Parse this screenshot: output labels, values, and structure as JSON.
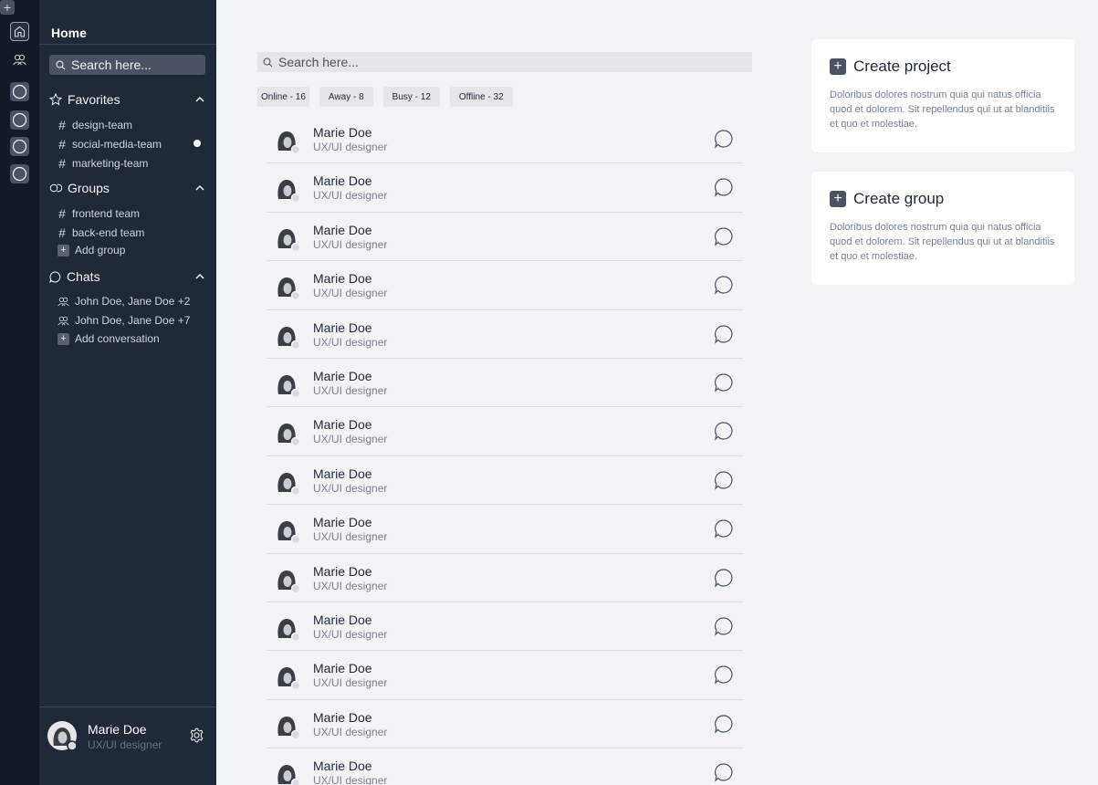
{
  "colors": {
    "rail_bg": "#131a26",
    "sidebar_bg": "#1f2938",
    "main_bg": "#f2f3f5",
    "card_bg": "#ffffff",
    "text_dark": "#1f2938",
    "text_muted": "#7b8290"
  },
  "rail": {
    "icons": [
      "home-icon",
      "people-icon",
      "circle-icon",
      "circle-icon",
      "circle-icon",
      "circle-icon",
      "plus-icon"
    ],
    "plus_glyph": "+"
  },
  "sidebar": {
    "title": "Home",
    "search_placeholder": "Search here...",
    "favorites": {
      "label": "Favorites",
      "items": [
        "design-team",
        "social-media-team",
        "marketing-team"
      ]
    },
    "groups": {
      "label": "Groups",
      "items": [
        "frontend team",
        "back-end team"
      ],
      "add_label": "Add group"
    },
    "chats": {
      "label": "Chats",
      "items": [
        "John Doe, Jane Doe +2",
        "John Doe, Jane Doe +7"
      ],
      "add_label": "Add conversation"
    },
    "user": {
      "name": "Marie Doe",
      "role": "UX/UI designer"
    }
  },
  "main": {
    "search_placeholder": "Search here...",
    "filters": [
      "Online - 16",
      "Away - 8",
      "Busy - 12",
      "Offline - 32"
    ],
    "members": [
      {
        "name": "Marie Doe",
        "role": "UX/UI designer"
      },
      {
        "name": "Marie Doe",
        "role": "UX/UI designer"
      },
      {
        "name": "Marie Doe",
        "role": "UX/UI designer"
      },
      {
        "name": "Marie Doe",
        "role": "UX/UI designer"
      },
      {
        "name": "Marie Doe",
        "role": "UX/UI designer"
      },
      {
        "name": "Marie Doe",
        "role": "UX/UI designer"
      },
      {
        "name": "Marie Doe",
        "role": "UX/UI designer"
      },
      {
        "name": "Marie Doe",
        "role": "UX/UI designer"
      },
      {
        "name": "Marie Doe",
        "role": "UX/UI designer"
      },
      {
        "name": "Marie Doe",
        "role": "UX/UI designer"
      },
      {
        "name": "Marie Doe",
        "role": "UX/UI designer"
      },
      {
        "name": "Marie Doe",
        "role": "UX/UI designer"
      },
      {
        "name": "Marie Doe",
        "role": "UX/UI designer"
      },
      {
        "name": "Marie Doe",
        "role": "UX/UI designer"
      }
    ]
  },
  "cards": {
    "project": {
      "title": "Create project",
      "description": "Doloribus dolores nostrum quia qui natus officia quod et dolorem. Sit repellendus qui ut at blanditiis et quo et molestiae."
    },
    "group": {
      "title": "Create group",
      "description": "Doloribus dolores nostrum quia qui natus officia quod et dolorem. Sit repellendus qui ut at blanditiis et quo et molestiae."
    },
    "plus_glyph": "+"
  }
}
